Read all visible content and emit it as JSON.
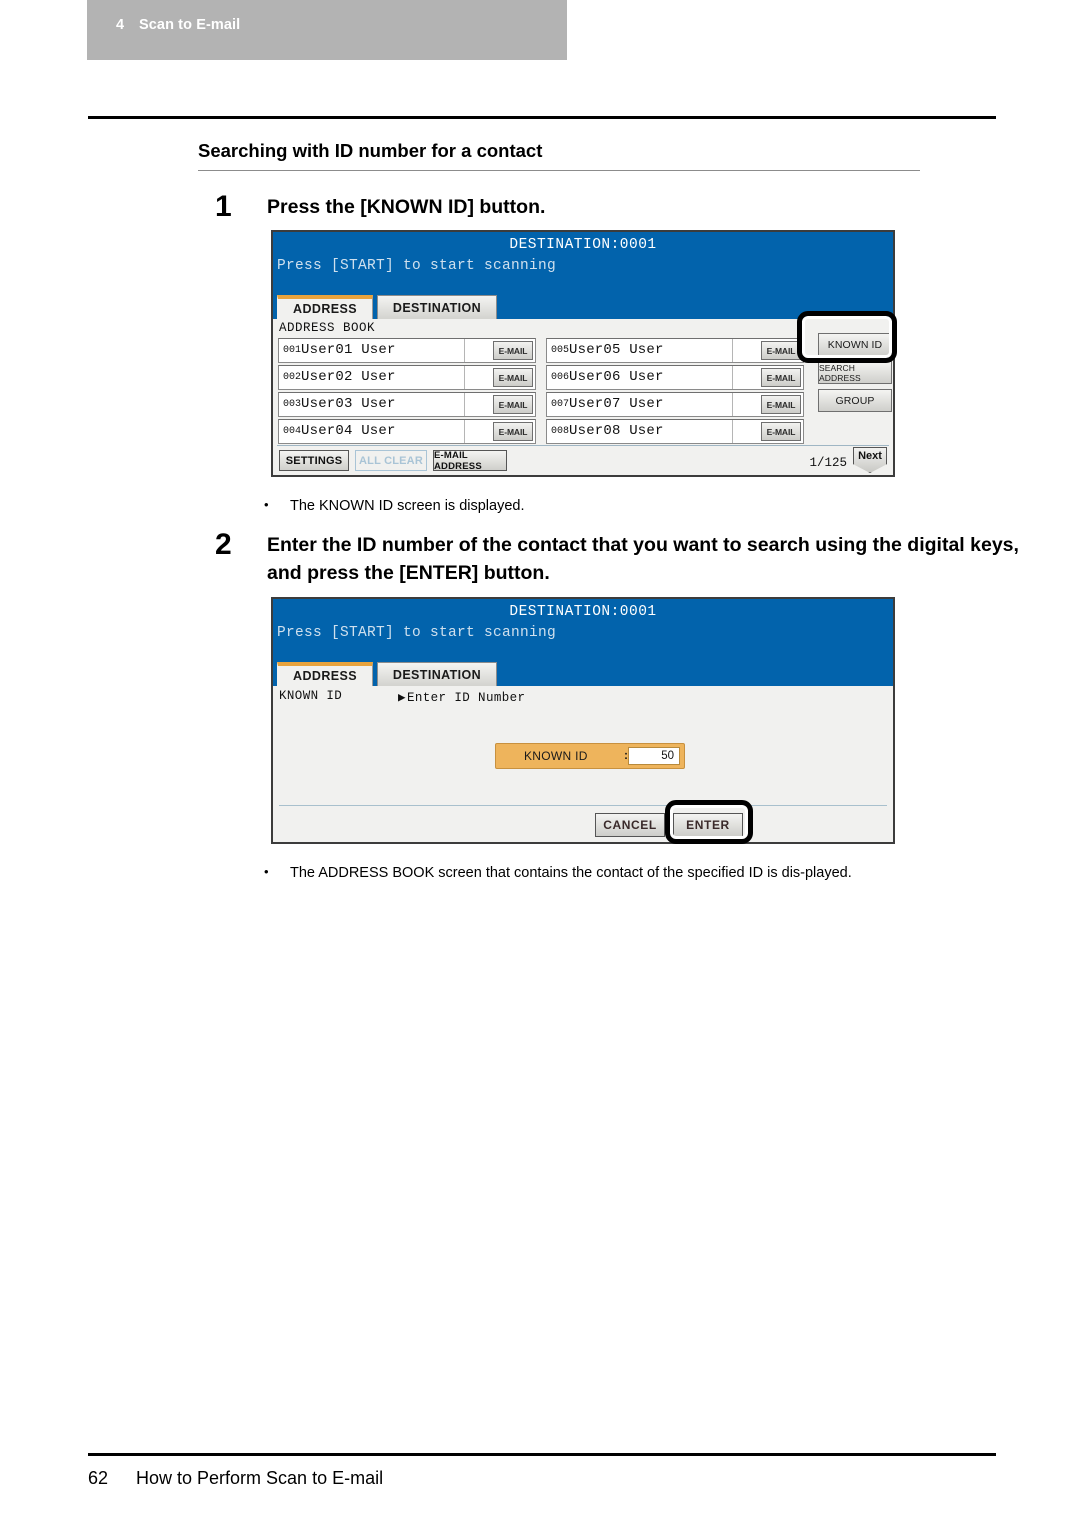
{
  "header": {
    "chapter_number": "4",
    "chapter_title": "Scan to E-mail"
  },
  "section": {
    "title": "Searching with ID number for a contact"
  },
  "steps": [
    {
      "number": "1",
      "text": "Press the [KNOWN ID] button."
    },
    {
      "number": "2",
      "text": "Enter the ID number of the contact that you want to search using the digital keys, and press the [ENTER] button."
    }
  ],
  "notes": [
    {
      "bullet": "•",
      "text": "The KNOWN ID screen is displayed."
    },
    {
      "bullet": "•",
      "text": "The ADDRESS BOOK screen that contains the contact of the specified ID is dis-played."
    }
  ],
  "footer": {
    "page_number": "62",
    "title": "How to Perform Scan to E-mail"
  },
  "screen1": {
    "destination": "DESTINATION:0001",
    "subtitle": "Press [START] to start scanning",
    "tabs": [
      {
        "label": "ADDRESS",
        "active": true
      },
      {
        "label": "DESTINATION",
        "active": false
      }
    ],
    "address_book_label": "ADDRESS BOOK",
    "contacts": [
      {
        "index": "001",
        "name": "User01 User",
        "button": "E-MAIL"
      },
      {
        "index": "002",
        "name": "User02 User",
        "button": "E-MAIL"
      },
      {
        "index": "003",
        "name": "User03 User",
        "button": "E-MAIL"
      },
      {
        "index": "004",
        "name": "User04 User",
        "button": "E-MAIL"
      },
      {
        "index": "005",
        "name": "User05 User",
        "button": "E-MAIL"
      },
      {
        "index": "006",
        "name": "User06 User",
        "button": "E-MAIL"
      },
      {
        "index": "007",
        "name": "User07 User",
        "button": "E-MAIL"
      },
      {
        "index": "008",
        "name": "User08 User",
        "button": "E-MAIL"
      }
    ],
    "side_buttons": [
      {
        "label": "KNOWN ID",
        "highlighted": true
      },
      {
        "label": "SEARCH ADDRESS",
        "highlighted": false
      },
      {
        "label": "GROUP",
        "highlighted": false
      }
    ],
    "footer_buttons": [
      {
        "label": "SETTINGS",
        "disabled": false
      },
      {
        "label": "ALL CLEAR",
        "disabled": true
      },
      {
        "label": "E-MAIL ADDRESS",
        "disabled": false
      }
    ],
    "page_count": "1/125",
    "next_label": "Next"
  },
  "screen2": {
    "destination": "DESTINATION:0001",
    "subtitle": "Press [START] to start scanning",
    "tabs": [
      {
        "label": "ADDRESS",
        "active": true
      },
      {
        "label": "DESTINATION",
        "active": false
      }
    ],
    "mode_label": "KNOWN ID",
    "prompt_marker": "▶",
    "prompt": "Enter ID Number",
    "field": {
      "label": "KNOWN ID",
      "separator": ":",
      "value": "50"
    },
    "buttons": [
      {
        "label": "CANCEL",
        "highlighted": false
      },
      {
        "label": "ENTER",
        "highlighted": true
      }
    ]
  },
  "colors": {
    "chapter_bar": "#b3b3b3",
    "lcd_header_blue": "#0263ac",
    "lcd_body": "#f1f1ef",
    "active_tab_accent": "#e8a33d",
    "field_orange": "#eeb45c",
    "highlight_ring": "#000000"
  }
}
